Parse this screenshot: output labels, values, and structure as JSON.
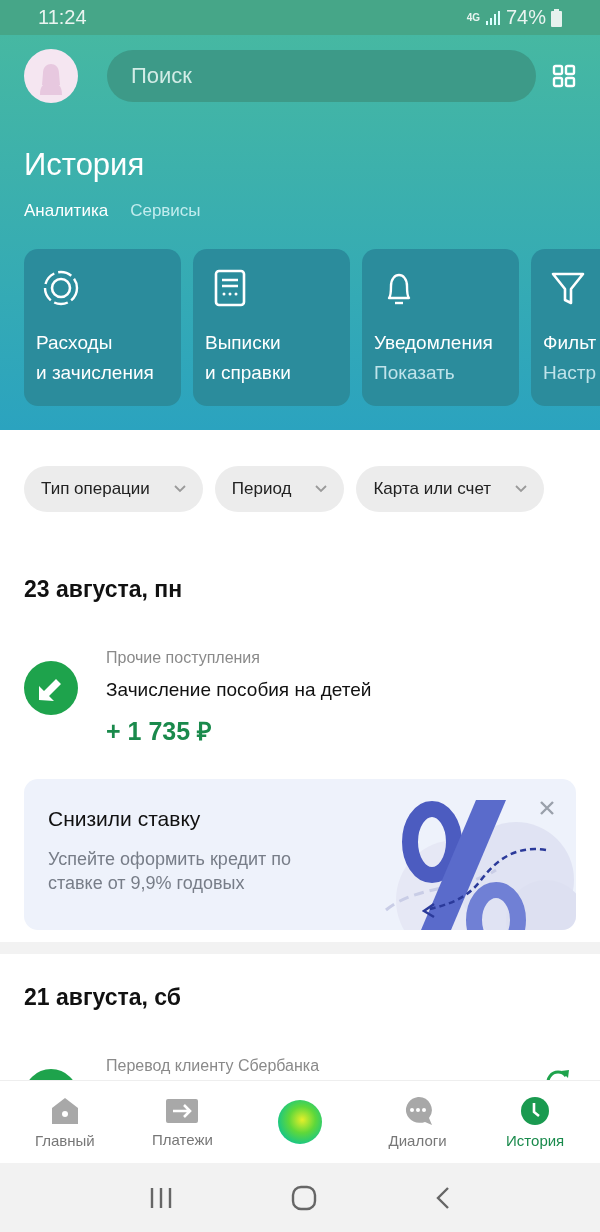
{
  "status_bar": {
    "time": "11:24",
    "network": "4G",
    "battery": "74%"
  },
  "header": {
    "search": {
      "placeholder": "Поиск"
    },
    "title": "История",
    "tabs": [
      {
        "label": "Аналитика",
        "selected": true
      },
      {
        "label": "Сервисы",
        "selected": false
      }
    ]
  },
  "quick_cards": [
    {
      "kind": "ring",
      "title": "Расходы\nи зачисления"
    },
    {
      "kind": "document",
      "title": "Выписки\nи справки"
    },
    {
      "kind": "bell",
      "title": "Уведомления",
      "subtitle": "Показать"
    },
    {
      "kind": "filter",
      "title": "Фильт",
      "subtitle": "Настр"
    }
  ],
  "filters": [
    {
      "label": "Тип операции"
    },
    {
      "label": "Период"
    },
    {
      "label": "Карта или счет"
    }
  ],
  "feed": [
    {
      "kind": "day",
      "date": "23 августа, пн",
      "transactions": [
        {
          "kind": "incoming",
          "category": "Прочие поступления",
          "title": "Зачисление пособия на детей",
          "amount": "+ 1 735 ₽"
        }
      ]
    },
    {
      "kind": "promo",
      "title": "Снизили ставку",
      "text": "Успейте оформить кредит по ставке от 9,9% годовых"
    },
    {
      "kind": "day",
      "date": "21 августа, сб",
      "transactions": [
        {
          "kind": "transfer",
          "category": "Перевод клиенту Сбербанка"
        }
      ]
    }
  ],
  "bottom_nav": [
    {
      "kind": "home",
      "label": "Главный",
      "selected": false
    },
    {
      "kind": "payments",
      "label": "Платежи",
      "selected": false
    },
    {
      "kind": "assistant",
      "selected": false
    },
    {
      "kind": "chat",
      "label": "Диалоги",
      "selected": false
    },
    {
      "kind": "clock",
      "label": "История",
      "selected": true
    }
  ]
}
